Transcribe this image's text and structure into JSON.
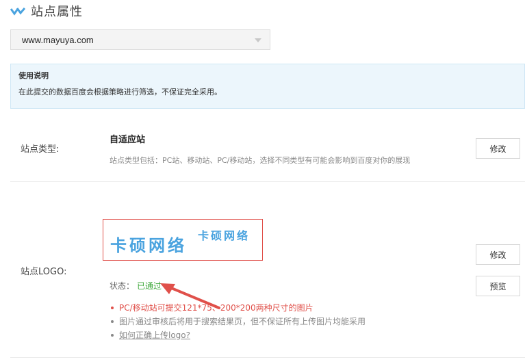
{
  "header": {
    "title": "站点属性",
    "logo_icon": "brand-check-icon"
  },
  "site_select": {
    "value": "www.mayuya.com",
    "caret_icon": "chevron-down-icon"
  },
  "notice": {
    "title": "使用说明",
    "text": "在此提交的数据百度会根据策略进行筛选，不保证完全采用。"
  },
  "site_type": {
    "label": "站点类型:",
    "value": "自适应站",
    "desc": "站点类型包括：PC站、移动站、PC/移动站，选择不同类型有可能会影响到百度对你的展现",
    "edit_label": "修改"
  },
  "site_logo": {
    "label": "站点LOGO:",
    "logo_text_large": "卡硕网络",
    "logo_text_small": "卡硕网络",
    "status_label": "状态：",
    "status_value": "已通过",
    "edit_label": "修改",
    "preview_label": "预览",
    "tips": [
      "PC/移动站可提交121*75、200*200两种尺寸的图片",
      "图片通过审核后将用于搜索结果页，但不保证所有上传图片均能采用"
    ],
    "help_link": "如何正确上传logo?"
  },
  "colors": {
    "accent_blue": "#4aa3df",
    "warn_red": "#e0504a",
    "ok_green": "#3fa83b",
    "notice_bg": "#ecf6fc"
  }
}
